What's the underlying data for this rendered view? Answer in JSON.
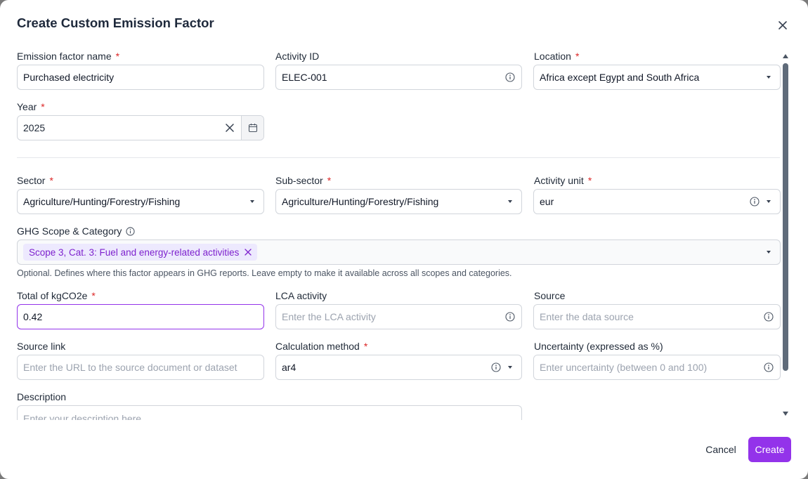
{
  "dialog": {
    "title": "Create Custom Emission Factor",
    "cancel_label": "Cancel",
    "create_label": "Create",
    "required_mark": "*"
  },
  "fields": {
    "name": {
      "label": "Emission factor name",
      "value": "Purchased electricity"
    },
    "activity_id": {
      "label": "Activity ID",
      "value": "ELEC-001"
    },
    "location": {
      "label": "Location",
      "value": "Africa except Egypt and South Africa"
    },
    "year": {
      "label": "Year",
      "value": "2025"
    },
    "sector": {
      "label": "Sector",
      "value": "Agriculture/Hunting/Forestry/Fishing"
    },
    "sub_sector": {
      "label": "Sub-sector",
      "value": "Agriculture/Hunting/Forestry/Fishing"
    },
    "activity_unit": {
      "label": "Activity unit",
      "value": "eur"
    },
    "ghg_scope": {
      "label": "GHG Scope & Category",
      "chip": "Scope 3, Cat. 3: Fuel and energy-related activities",
      "help": "Optional. Defines where this factor appears in GHG reports. Leave empty to make it available across all scopes and categories."
    },
    "total_kgco2e": {
      "label": "Total of kgCO2e",
      "value": "0.42"
    },
    "lca_activity": {
      "label": "LCA activity",
      "placeholder": "Enter the LCA activity"
    },
    "source": {
      "label": "Source",
      "placeholder": "Enter the data source"
    },
    "source_link": {
      "label": "Source link",
      "placeholder": "Enter the URL to the source document or dataset"
    },
    "calculation_method": {
      "label": "Calculation method",
      "value": "ar4"
    },
    "uncertainty": {
      "label": "Uncertainty (expressed as %)",
      "placeholder": "Enter uncertainty (between 0 and 100)"
    },
    "description": {
      "label": "Description",
      "placeholder": "Enter your description here"
    }
  },
  "colors": {
    "accent": "#9333ea",
    "required": "#dc2626",
    "chip_bg": "#ede9fe",
    "chip_text": "#7e22ce"
  },
  "icons": [
    "close-icon",
    "info-icon",
    "chevron-down-icon",
    "clear-icon",
    "calendar-icon",
    "chip-remove-icon"
  ]
}
